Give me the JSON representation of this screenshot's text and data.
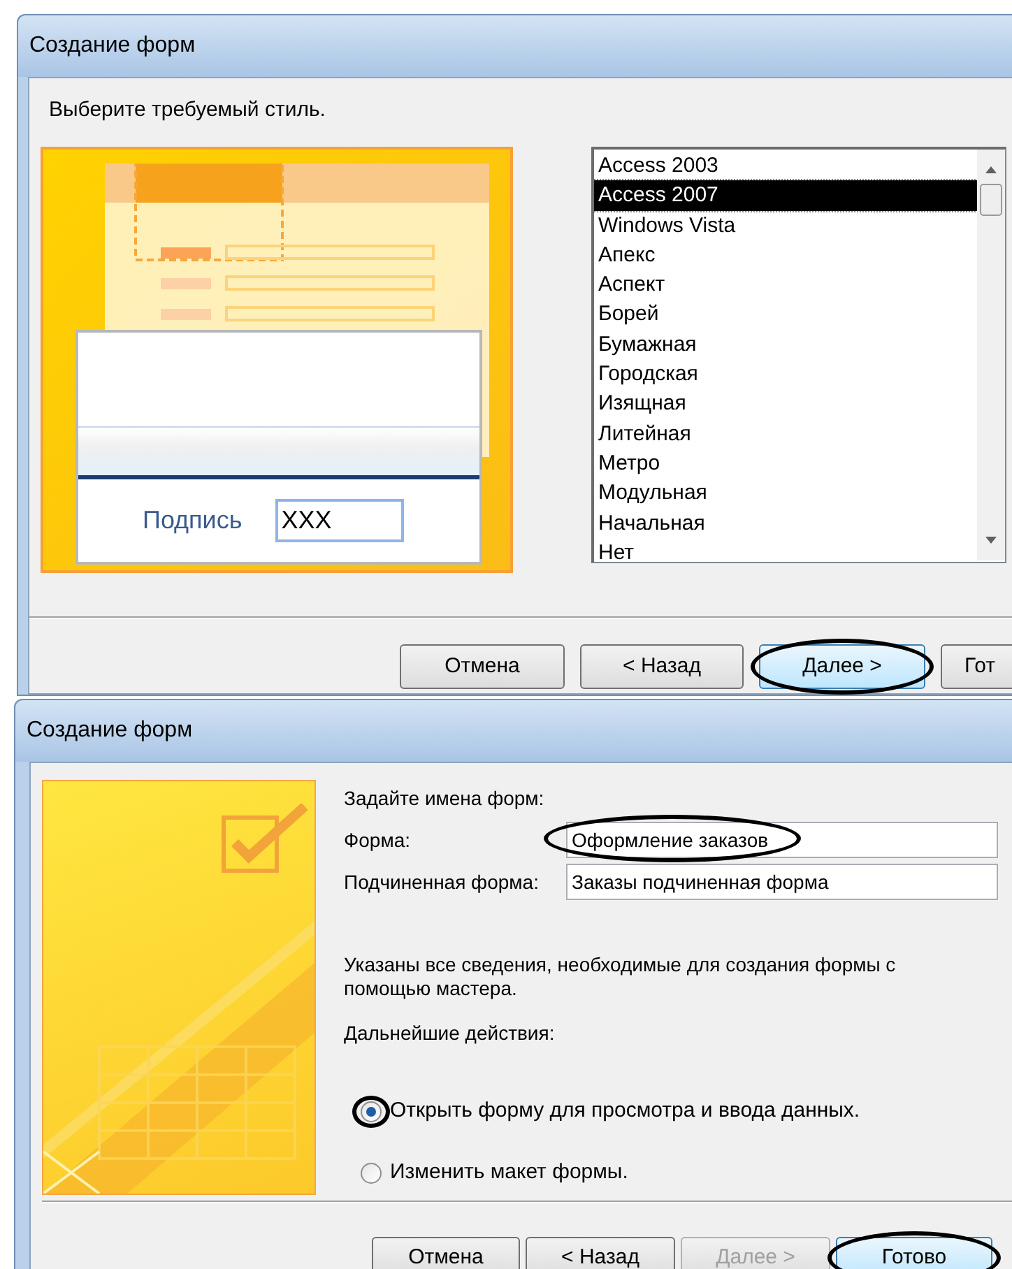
{
  "top_dialog": {
    "title": "Создание форм",
    "prompt": "Выберите требуемый стиль.",
    "preview": {
      "label": "Подпись",
      "field_value": "XXX"
    },
    "styles": [
      {
        "label": "Access 2003",
        "selected": false
      },
      {
        "label": "Access 2007",
        "selected": true
      },
      {
        "label": "Windows Vista",
        "selected": false
      },
      {
        "label": "Апекс",
        "selected": false
      },
      {
        "label": "Аспект",
        "selected": false
      },
      {
        "label": "Борей",
        "selected": false
      },
      {
        "label": "Бумажная",
        "selected": false
      },
      {
        "label": "Городская",
        "selected": false
      },
      {
        "label": "Изящная",
        "selected": false
      },
      {
        "label": "Литейная",
        "selected": false
      },
      {
        "label": "Метро",
        "selected": false
      },
      {
        "label": "Модульная",
        "selected": false
      },
      {
        "label": "Начальная",
        "selected": false
      },
      {
        "label": "Нет",
        "selected": false
      }
    ],
    "buttons": [
      {
        "label": "Отмена",
        "default": false,
        "disabled": false,
        "circled": false
      },
      {
        "label": "< Назад",
        "default": false,
        "disabled": false,
        "circled": false
      },
      {
        "label": "Далее >",
        "default": true,
        "disabled": false,
        "circled": true
      },
      {
        "label": "Гот",
        "default": false,
        "disabled": false,
        "circled": false
      }
    ]
  },
  "bottom_dialog": {
    "title": "Создание форм",
    "heading": "Задайте имена форм:",
    "fields": [
      {
        "label": "Форма:",
        "value": "Оформление заказов",
        "circled": true
      },
      {
        "label": "Подчиненная форма:",
        "value": "Заказы подчиненная форма",
        "circled": false
      }
    ],
    "info": "Указаны все сведения, необходимые для создания формы с помощью мастера.",
    "actions_label": "Дальнейшие действия:",
    "options": [
      {
        "label": "Открыть форму для просмотра и ввода данных.",
        "selected": true,
        "circled": true
      },
      {
        "label": "Изменить макет формы.",
        "selected": false,
        "circled": false
      }
    ],
    "buttons": [
      {
        "label": "Отмена",
        "default": false,
        "disabled": false,
        "circled": false
      },
      {
        "label": "< Назад",
        "default": false,
        "disabled": false,
        "circled": false
      },
      {
        "label": "Далее >",
        "default": false,
        "disabled": true,
        "circled": false
      },
      {
        "label": "Готово",
        "default": true,
        "disabled": false,
        "circled": true
      }
    ]
  }
}
